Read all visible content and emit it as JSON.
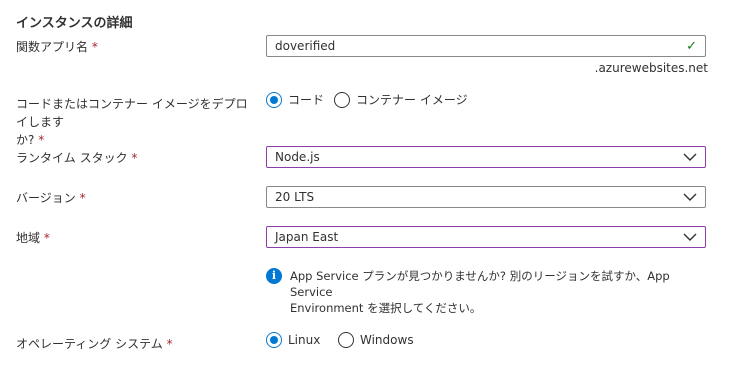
{
  "section_title": "インスタンスの詳細",
  "required_mark": "*",
  "function_app_name": {
    "label": "関数アプリ名",
    "value": "doverified",
    "suffix": ".azurewebsites.net"
  },
  "deploy": {
    "label_line1": "コードまたはコンテナー イメージをデプロイします",
    "label_line2": "か?",
    "options": [
      "コード",
      "コンテナー イメージ"
    ],
    "selected": "コード"
  },
  "runtime_stack": {
    "label": "ランタイム スタック",
    "value": "Node.js"
  },
  "version": {
    "label": "バージョン",
    "value": "20 LTS"
  },
  "region": {
    "label": "地域",
    "value": "Japan East"
  },
  "info": {
    "line1": "App Service プランが見つかりませんか? 別のリージョンを試すか、App Service",
    "line2": "Environment を選択してください。"
  },
  "os": {
    "label": "オペレーティング システム",
    "options": [
      "Linux",
      "Windows"
    ],
    "selected": "Linux"
  },
  "colors": {
    "accent": "#0078d4",
    "focus_border": "#8a3fa8",
    "valid_check": "#107c10",
    "required": "#a4262c"
  }
}
